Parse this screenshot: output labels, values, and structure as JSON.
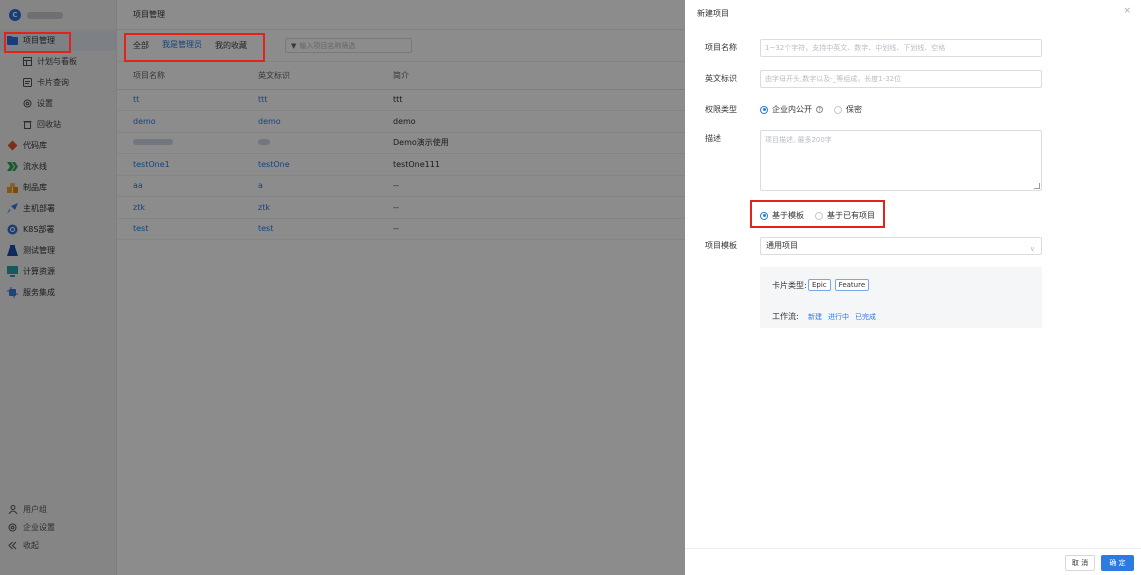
{
  "sidebar": {
    "logo_letter": "C",
    "items": [
      {
        "label": "项目管理",
        "icon": "folder-icon",
        "color": "#2d6fdc"
      },
      {
        "label": "计划与看板",
        "icon": "board-icon",
        "color": "#555555"
      },
      {
        "label": "卡片查询",
        "icon": "card-icon",
        "color": "#555555"
      },
      {
        "label": "设置",
        "icon": "gear-icon",
        "color": "#555555"
      },
      {
        "label": "回收站",
        "icon": "trash-icon",
        "color": "#555555"
      },
      {
        "label": "代码库",
        "icon": "git-icon",
        "color": "#e2552e"
      },
      {
        "label": "流水线",
        "icon": "pipeline-icon",
        "color": "#2fa84f"
      },
      {
        "label": "制品库",
        "icon": "package-icon",
        "color": "#f0a020"
      },
      {
        "label": "主机部署",
        "icon": "rocket-icon",
        "color": "#3a7bdc"
      },
      {
        "label": "K8S部署",
        "icon": "k8s-icon",
        "color": "#3a6fd0"
      },
      {
        "label": "测试管理",
        "icon": "test-icon",
        "color": "#1b4fa8"
      },
      {
        "label": "计算资源",
        "icon": "compute-icon",
        "color": "#2aa0a8"
      },
      {
        "label": "服务集成",
        "icon": "integration-icon",
        "color": "#3a7bdc"
      }
    ],
    "bottom": [
      {
        "label": "用户组",
        "icon": "users-icon"
      },
      {
        "label": "企业设置",
        "icon": "gear-icon"
      },
      {
        "label": "收起",
        "icon": "collapse-icon"
      }
    ]
  },
  "main": {
    "title": "项目管理",
    "tabs": [
      "全部",
      "我是管理员",
      "我的收藏"
    ],
    "filter_placeholder": "输入项目名称筛选",
    "columns": [
      "项目名称",
      "英文标识",
      "简介"
    ],
    "rows": [
      [
        "tt",
        "ttt",
        "ttt"
      ],
      [
        "demo",
        "demo",
        "demo"
      ],
      [
        "",
        "",
        "Demo演示使用"
      ],
      [
        "testOne1",
        "testOne",
        "testOne111"
      ],
      [
        "aa",
        "a",
        "--"
      ],
      [
        "ztk",
        "ztk",
        "--"
      ],
      [
        "test",
        "test",
        "--"
      ]
    ]
  },
  "drawer": {
    "title": "新建项目",
    "close": "×",
    "name_label": "项目名称",
    "name_placeholder": "1~32个字符，支持中英文、数字、中划线、下划线、空格",
    "en_label": "英文标识",
    "en_placeholder": "由字母开头,数字以及-_等组成，长度1-32位",
    "perm_label": "权限类型",
    "perm_options": [
      "企业内公开",
      "保密"
    ],
    "perm_help": "?",
    "desc_label": "描述",
    "desc_placeholder": "项目描述, 最多200字",
    "base_options": [
      "基于模板",
      "基于已有项目"
    ],
    "template_label": "项目模板",
    "template_value": "通用项目",
    "card_type_label": "卡片类型:",
    "card_types": [
      "Epic",
      "Feature"
    ],
    "workflow_label": "工作流:",
    "workflow_states": [
      "新建",
      "进行中",
      "已完成"
    ],
    "cancel": "取 消",
    "ok": "确 定"
  },
  "colors": {
    "accent": "#2d7ae0",
    "highlight": "#e2231a"
  }
}
